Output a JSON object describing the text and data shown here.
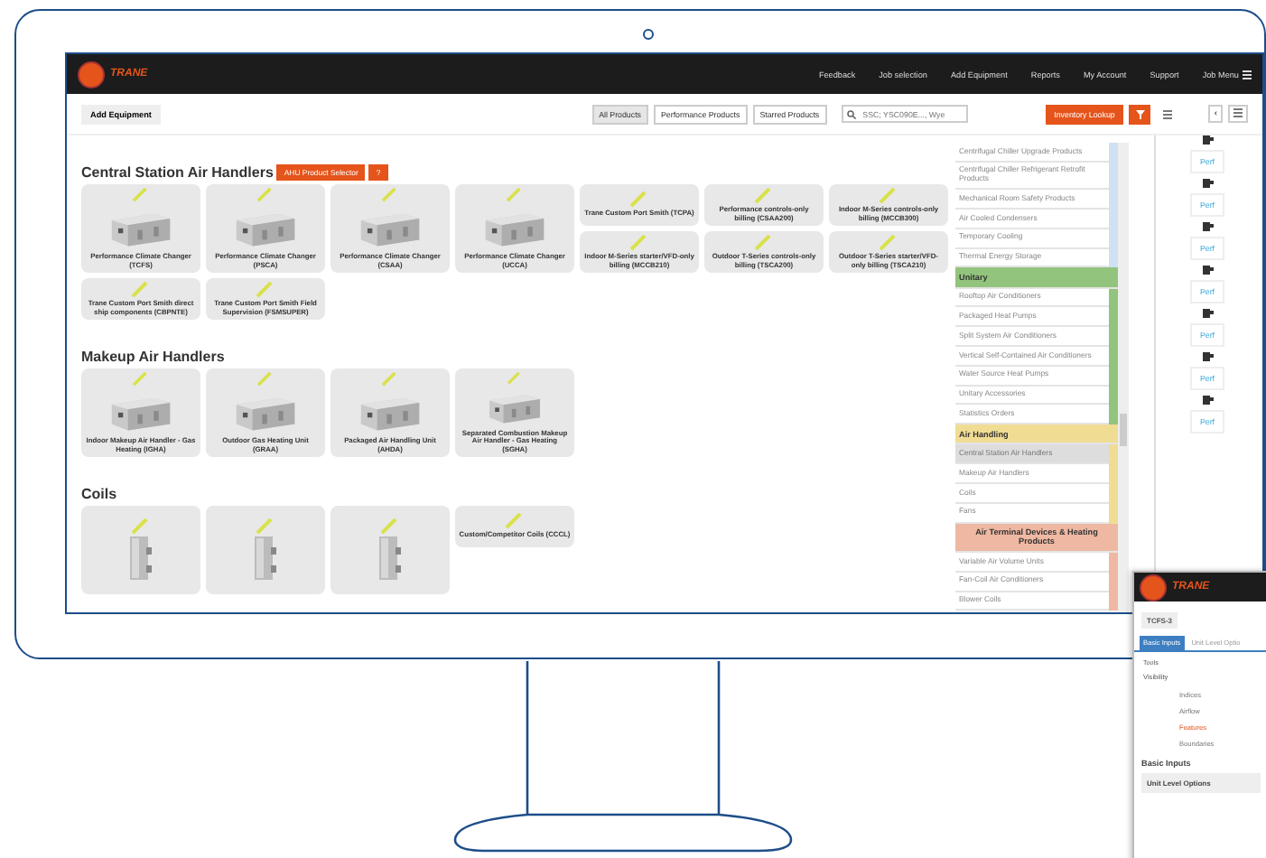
{
  "nav": {
    "logo": "TRANE",
    "links": [
      "Feedback",
      "Job selection",
      "Add Equipment",
      "Reports",
      "My Account",
      "Support",
      "Job Menu"
    ]
  },
  "toolbar": {
    "add_button": "Add Equipment",
    "filters": [
      {
        "label": "All Products",
        "selected": true
      },
      {
        "label": "Performance Products",
        "selected": false
      },
      {
        "label": "Starred Products",
        "selected": false
      }
    ],
    "search": {
      "placeholder": "SSC; YSC090E..., Wye"
    },
    "inventory_button": "Inventory Lookup"
  },
  "sections": [
    {
      "title": "Central Station Air Handlers",
      "actions": [
        "AHU Product Selector",
        "?"
      ],
      "products": [
        {
          "name": "Performance Climate Changer (TCFS)"
        },
        {
          "name": "Performance Climate Changer (PSCA)"
        },
        {
          "name": "Performance Climate Changer (CSAA)"
        },
        {
          "name": "Performance Climate Changer (UCCA)"
        },
        {
          "kind": "text",
          "name": "Trane Custom Port Smith (TCPA)"
        },
        {
          "kind": "text",
          "name": "Performance controls-only billing (CSAA200)"
        },
        {
          "kind": "text",
          "name": "Indoor M-Series controls-only billing (MCCB300)"
        },
        {
          "kind": "text",
          "name": "Indoor M-Series starter/VFD-only billing (MCCB210)"
        },
        {
          "kind": "text",
          "name": "Outdoor T-Series controls-only billing (TSCA200)"
        },
        {
          "kind": "text",
          "name": "Outdoor T-Series starter/VFD-only billing (TSCA210)"
        },
        {
          "kind": "text",
          "name": "Trane Custom Port Smith direct ship components (CBPNTE)"
        },
        {
          "kind": "text",
          "name": "Trane Custom Port Smith Field Supervision (FSMSUPER)"
        }
      ]
    },
    {
      "title": "Makeup Air Handlers",
      "products": [
        {
          "name": "Indoor Makeup Air Handler - Gas Heating (IGHA)"
        },
        {
          "name": "Outdoor Gas Heating Unit (GRAA)"
        },
        {
          "name": "Packaged Air Handling Unit (AHDA)"
        },
        {
          "name": "Separated Combustion Makeup Air Handler - Gas Heating (SGHA)"
        }
      ]
    },
    {
      "title": "Coils",
      "products": [
        {
          "kind": "coil"
        },
        {
          "kind": "coil"
        },
        {
          "kind": "coil"
        },
        {
          "kind": "text",
          "name": "Custom/Competitor Coils (CCCL)"
        }
      ]
    }
  ],
  "category_list": {
    "groups": [
      {
        "color": "#cfe2f3",
        "items": [
          {
            "label": "Centrifugal Chiller Upgrade Products",
            "selected": false
          },
          {
            "label": "Centrifugal Chiller Refrigerant Retrofit Products",
            "selected": false
          },
          {
            "label": "Mechanical Room Safety Products",
            "selected": false
          },
          {
            "label": "Air Cooled Condensers",
            "selected": false
          },
          {
            "label": "Temporary Cooling",
            "selected": false
          },
          {
            "label": "Thermal Energy Storage",
            "selected": false
          }
        ]
      },
      {
        "header": "Unitary",
        "color": "#93c47d",
        "items": [
          {
            "label": "Rooftop Air Conditioners",
            "selected": false
          },
          {
            "label": "Packaged Heat Pumps",
            "selected": false
          },
          {
            "label": "Split System Air Conditioners",
            "selected": false
          },
          {
            "label": "Vertical Self-Contained Air Conditioners",
            "selected": false
          },
          {
            "label": "Water Source Heat Pumps",
            "selected": false
          },
          {
            "label": "Unitary Accessories",
            "selected": false
          },
          {
            "label": "Statistics Orders",
            "selected": false
          }
        ]
      },
      {
        "header": "Air Handling",
        "color": "#f1dc94",
        "items": [
          {
            "label": "Central Station Air Handlers",
            "selected": true
          },
          {
            "label": "Makeup Air Handlers",
            "selected": false
          },
          {
            "label": "Coils",
            "selected": false
          },
          {
            "label": "Fans",
            "selected": false
          }
        ]
      },
      {
        "header": "Air Terminal Devices & Heating Products",
        "color": "#efb8a2",
        "items": [
          {
            "label": "Variable Air Volume Units",
            "selected": false
          },
          {
            "label": "Fan-Coil Air Conditioners",
            "selected": false
          },
          {
            "label": "Blower Coils",
            "selected": false
          }
        ]
      }
    ]
  },
  "side_panel": {
    "back": "‹",
    "links": [
      "Perf",
      "Perf",
      "Perf",
      "Perf",
      "Perf",
      "Perf",
      "Perf"
    ]
  },
  "overlay_window": {
    "logo": "TRANE",
    "equipment_tag": "TCFS-3",
    "tabs": [
      {
        "label": "Basic Inputs",
        "selected": true
      },
      {
        "label": "Unit Level Optio",
        "selected": false
      }
    ],
    "tools_label": "Tools",
    "visibility_label": "Visibility",
    "menu_items": [
      {
        "label": "Indices",
        "selected": false
      },
      {
        "label": "Airflow",
        "selected": false
      },
      {
        "label": "Features",
        "selected": true
      },
      {
        "label": "Boundaries",
        "selected": false
      }
    ],
    "heading": "Basic Inputs",
    "options_bar": "Unit Level Options"
  }
}
